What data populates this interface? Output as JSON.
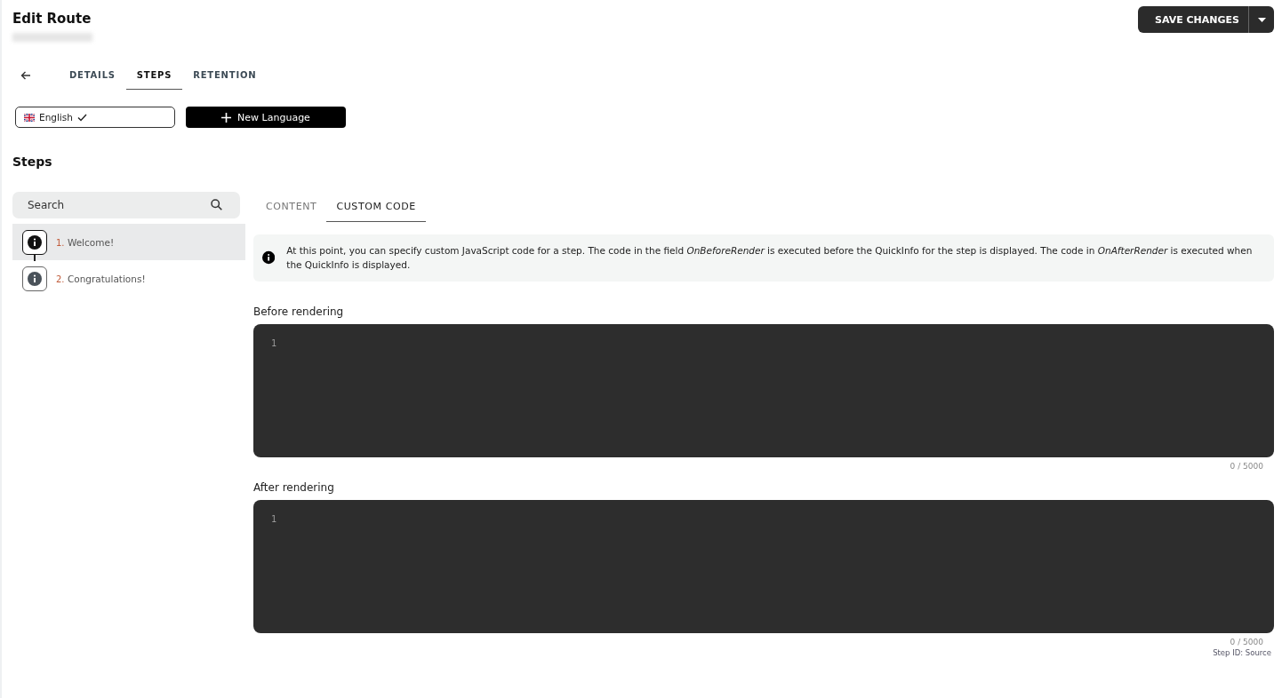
{
  "header": {
    "title": "Edit Route",
    "save_button": "SAVE CHANGES"
  },
  "tabs": [
    {
      "label": "DETAILS",
      "selected": false
    },
    {
      "label": "STEPS",
      "selected": true
    },
    {
      "label": "RETENTION",
      "selected": false
    }
  ],
  "languages": [
    {
      "label": "English",
      "checked": true
    }
  ],
  "new_language_button": "New Language",
  "steps_heading": "Steps",
  "search": {
    "placeholder": "Search"
  },
  "steps": [
    {
      "number": "1.",
      "label": "Welcome!",
      "selected": true
    },
    {
      "number": "2.",
      "label": "Congratulations!",
      "selected": false
    }
  ],
  "editor_tabs": [
    {
      "label": "CONTENT",
      "selected": false
    },
    {
      "label": "CUSTOM CODE",
      "selected": true
    }
  ],
  "info": "At this point, you can specify custom JavaScript code for a step. The code in the field *OnBeforeRender* is executed before the QuickInfo for the step is displayed. The code in *OnAfterRender* is executed when the QuickInfo is displayed.",
  "editors": [
    {
      "label": "Before rendering",
      "line_number": "1",
      "counter": "0 / 5000"
    },
    {
      "label": "After rendering",
      "line_number": "1",
      "counter": "0 / 5000"
    }
  ],
  "step_id": "Step ID: Source"
}
